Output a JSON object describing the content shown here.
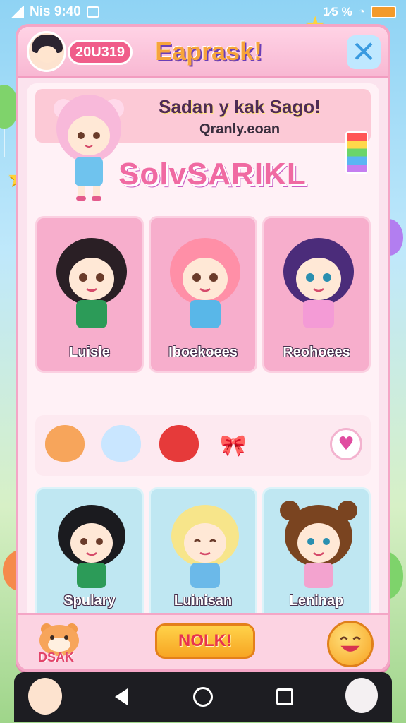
{
  "status_bar": {
    "left_text": "Nis 9:40",
    "right_text": "1⁄5 %"
  },
  "header": {
    "score": "20U319",
    "title": "Eaprask!",
    "close_icon": "close-icon"
  },
  "greeting": {
    "line1": "Sadan y kak Sago!",
    "line2": "Qranly.eoan"
  },
  "subtitle": "SolvSARIKL",
  "top_cards": [
    {
      "label": "Luisle",
      "hair": "#2a1f25",
      "dress": "#2c9b58"
    },
    {
      "label": "Iboekoees",
      "hair": "#ff8fa7",
      "dress": "#59b7e8"
    },
    {
      "label": "Reohoees",
      "hair": "#4b2c7a",
      "dress": "#f49bd6"
    }
  ],
  "pets": [
    {
      "name": "hamster-pet",
      "color": "#f7a55b"
    },
    {
      "name": "rainbow-pet",
      "color": "#c9e6ff"
    },
    {
      "name": "red-bear-pet",
      "color": "#e63a3a"
    }
  ],
  "bottom_cards": [
    {
      "label": "Spulary",
      "hair": "#1b1b1f",
      "dress": "#2c9b58"
    },
    {
      "label": "Luinisan",
      "hair": "#f7e58a",
      "dress": "#6bb9e9"
    },
    {
      "label": "Leninap",
      "hair": "#7a4420",
      "dress": "#f3a3cf"
    }
  ],
  "footer": {
    "logo_text": "DSAK",
    "play_label": "NOLK!"
  },
  "colors": {
    "frame": "#f4a6c6",
    "panel": "#fbe3ee",
    "accent": "#f05d8a"
  }
}
